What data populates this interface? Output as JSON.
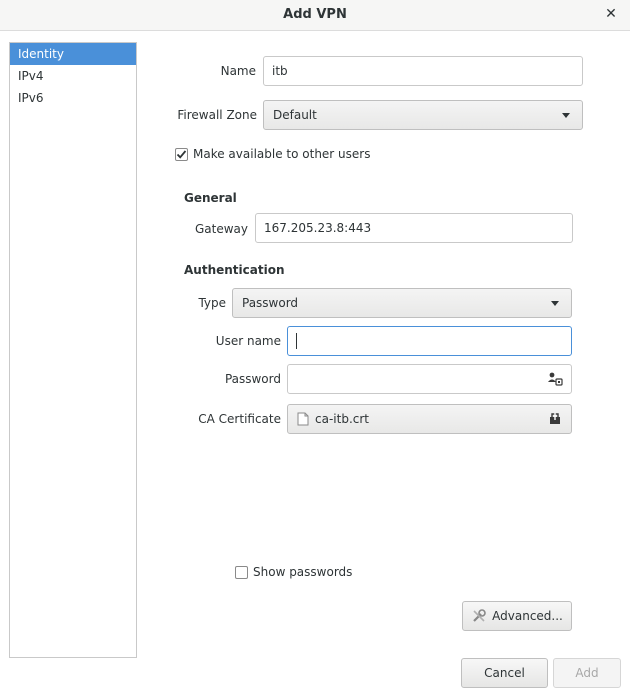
{
  "window": {
    "title": "Add VPN"
  },
  "sidebar": {
    "items": [
      {
        "label": "Identity"
      },
      {
        "label": "IPv4"
      },
      {
        "label": "IPv6"
      }
    ]
  },
  "identity": {
    "name_label": "Name",
    "name_value": "itb",
    "zone_label": "Firewall Zone",
    "zone_value": "Default",
    "available_label": "Make available to other users",
    "available_checked": true
  },
  "general": {
    "heading": "General",
    "gateway_label": "Gateway",
    "gateway_value": "167.205.23.8:443"
  },
  "auth": {
    "heading": "Authentication",
    "type_label": "Type",
    "type_value": "Password",
    "username_label": "User name",
    "username_value": "",
    "password_label": "Password",
    "password_value": "",
    "ca_label": "CA Certificate",
    "ca_value": "ca-itb.crt"
  },
  "show_passwords_label": "Show passwords",
  "advanced_label": "Advanced...",
  "footer": {
    "cancel_label": "Cancel",
    "add_label": "Add"
  }
}
